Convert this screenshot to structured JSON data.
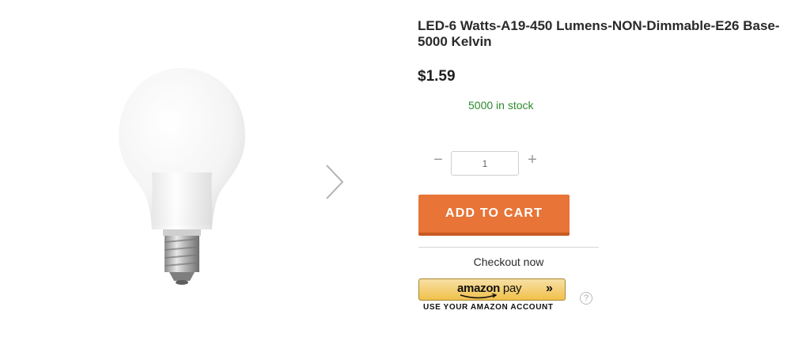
{
  "product": {
    "title": "LED-6 Watts-A19-450 Lumens-NON-Dimmable-E26 Base-5000 Kelvin",
    "price": "$1.59",
    "stock": "5000 in stock"
  },
  "quantity": {
    "value": "1",
    "minus_symbol": "−",
    "plus_symbol": "+"
  },
  "actions": {
    "add_to_cart_label": "ADD TO CART",
    "checkout_now_label": "Checkout now"
  },
  "amazon_pay": {
    "caption": "USE YOUR AMAZON ACCOUNT",
    "help_symbol": "?"
  },
  "gallery": {
    "image_icon": "light-bulb-image",
    "next_icon": "chevron-right-icon"
  },
  "colors": {
    "accent": "#e87437",
    "stock_green": "#2d8a2d",
    "amazon_gold": "#f0c14b"
  }
}
